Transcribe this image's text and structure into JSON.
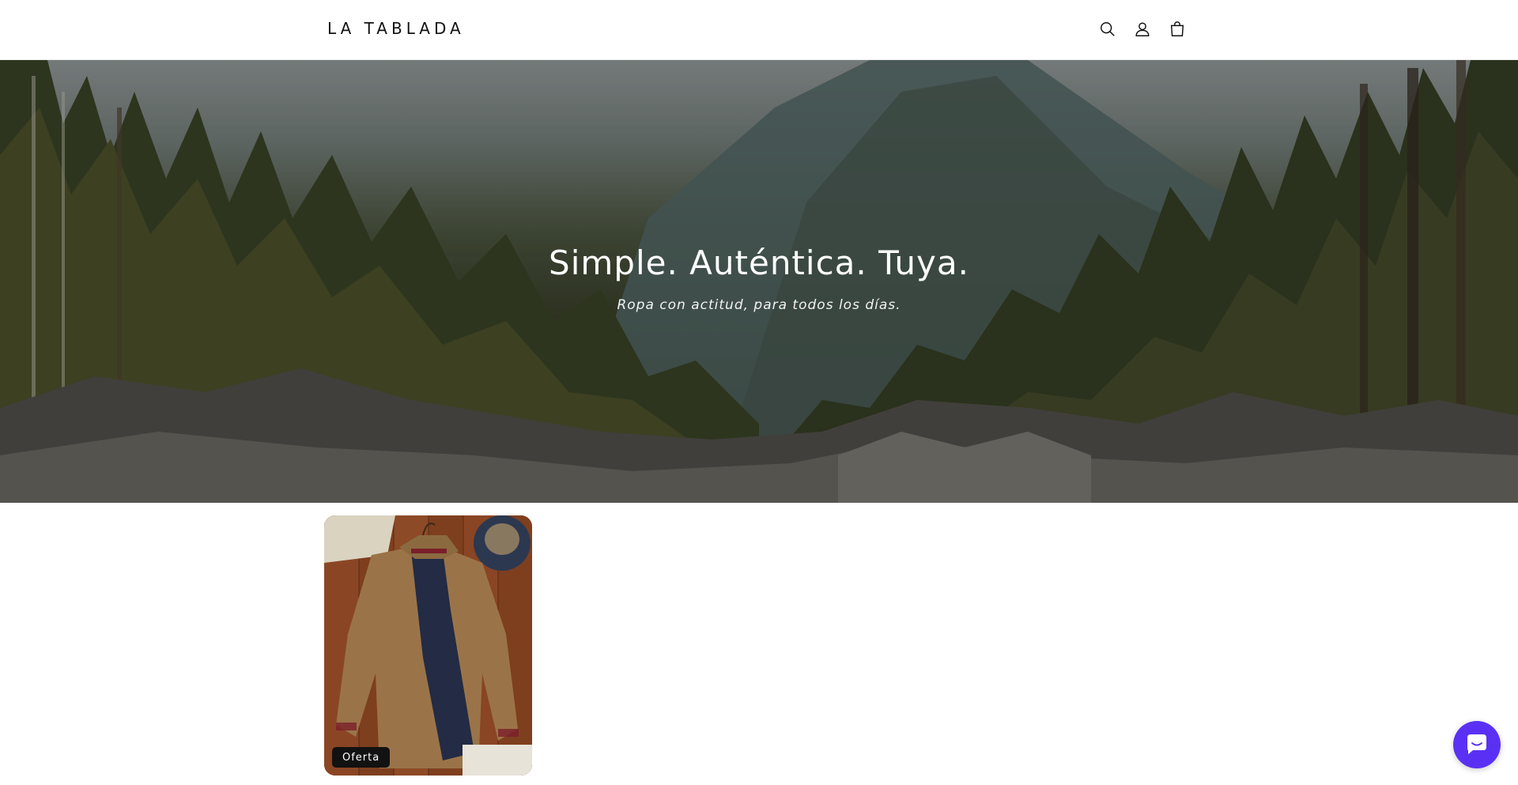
{
  "header": {
    "logo_text": "LA TABLADA",
    "icons": [
      "search-icon",
      "account-icon",
      "cart-icon"
    ]
  },
  "hero": {
    "title": "Simple. Auténtica. Tuya.",
    "subtitle": "Ropa con actitud, para todos los días."
  },
  "products": [
    {
      "badge": "Oferta"
    }
  ],
  "chat": {
    "icon": "chat-icon",
    "color": "#5a31f4"
  },
  "colors": {
    "text": "#121212",
    "badge_bg": "#121212",
    "badge_text": "#ffffff",
    "background": "#ffffff"
  }
}
